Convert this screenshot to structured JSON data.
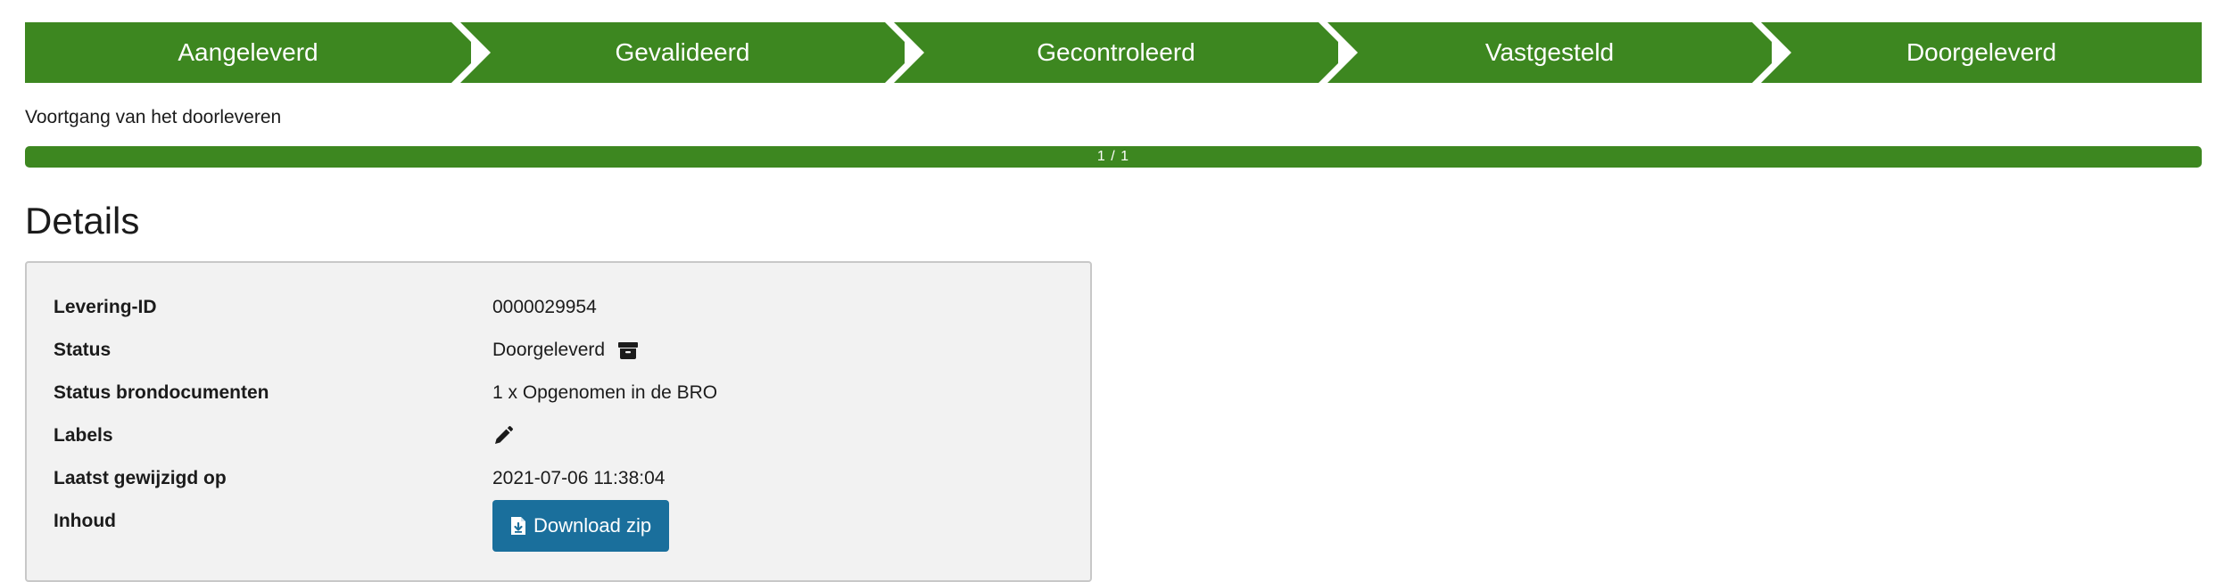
{
  "steps": [
    {
      "label": "Aangeleverd"
    },
    {
      "label": "Gevalideerd"
    },
    {
      "label": "Gecontroleerd"
    },
    {
      "label": "Vastgesteld"
    },
    {
      "label": "Doorgeleverd"
    }
  ],
  "progress": {
    "label": "Voortgang van het doorleveren",
    "text": "1 / 1",
    "fraction": 1.0
  },
  "details": {
    "title": "Details",
    "rows": [
      {
        "key": "Levering-ID",
        "value": "0000029954"
      },
      {
        "key": "Status",
        "value": "Doorgeleverd",
        "icon": "archive-icon"
      },
      {
        "key": "Status brondocumenten",
        "value": "1 x Opgenomen in de BRO"
      },
      {
        "key": "Labels",
        "value": "",
        "icon": "pencil-icon"
      },
      {
        "key": "Laatst gewijzigd op",
        "value": "2021-07-06 11:38:04"
      },
      {
        "key": "Inhoud",
        "button": "Download zip",
        "icon": "file-download-icon"
      }
    ]
  },
  "colors": {
    "step_green": "#3d8720",
    "button_blue": "#1a6f9c",
    "panel_bg": "#f2f2f2"
  }
}
